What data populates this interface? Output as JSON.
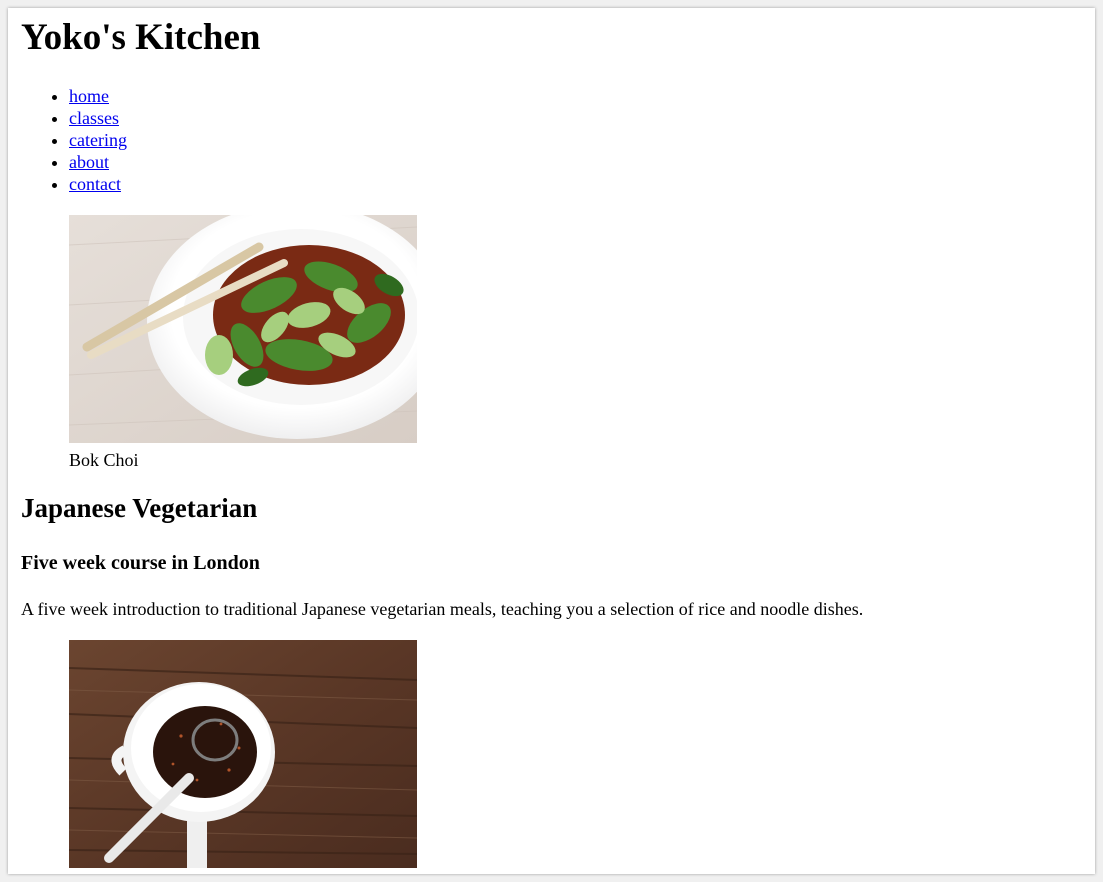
{
  "header": {
    "title": "Yoko's Kitchen"
  },
  "nav": {
    "items": [
      {
        "label": "home"
      },
      {
        "label": "classes"
      },
      {
        "label": "catering"
      },
      {
        "label": "about"
      },
      {
        "label": "contact"
      }
    ]
  },
  "article1": {
    "figure": {
      "caption": "Bok Choi"
    },
    "heading": "Japanese Vegetarian",
    "subheading": "Five week course in London",
    "description": "A five week introduction to traditional Japanese vegetarian meals, teaching you a selection of rice and noodle dishes."
  }
}
